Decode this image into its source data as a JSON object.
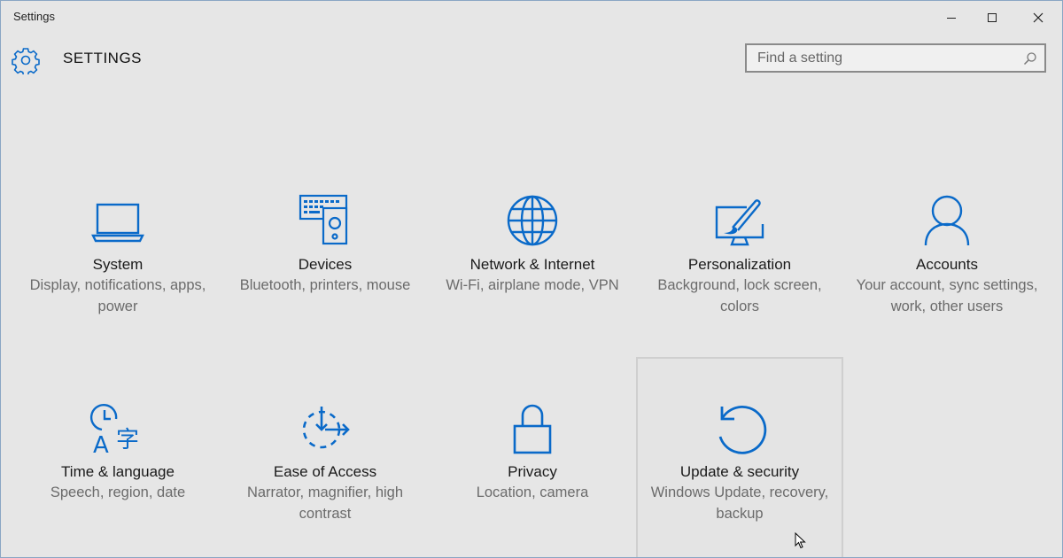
{
  "window": {
    "title": "Settings"
  },
  "header": {
    "title": "SETTINGS",
    "search_placeholder": "Find a setting"
  },
  "accent_color": "#0a6ac9",
  "categories": [
    {
      "name": "System",
      "desc": "Display, notifications, apps, power",
      "icon": "laptop-icon"
    },
    {
      "name": "Devices",
      "desc": "Bluetooth, printers, mouse",
      "icon": "devices-icon"
    },
    {
      "name": "Network & Internet",
      "desc": "Wi-Fi, airplane mode, VPN",
      "icon": "globe-icon"
    },
    {
      "name": "Personalization",
      "desc": "Background, lock screen, colors",
      "icon": "paintbrush-monitor-icon"
    },
    {
      "name": "Accounts",
      "desc": "Your account, sync settings, work, other users",
      "icon": "person-icon"
    },
    {
      "name": "Time & language",
      "desc": "Speech, region, date",
      "icon": "clock-language-icon"
    },
    {
      "name": "Ease of Access",
      "desc": "Narrator, magnifier, high contrast",
      "icon": "ease-of-access-icon"
    },
    {
      "name": "Privacy",
      "desc": "Location, camera",
      "icon": "lock-icon"
    },
    {
      "name": "Update & security",
      "desc": "Windows Update, recovery, backup",
      "icon": "refresh-icon"
    }
  ]
}
